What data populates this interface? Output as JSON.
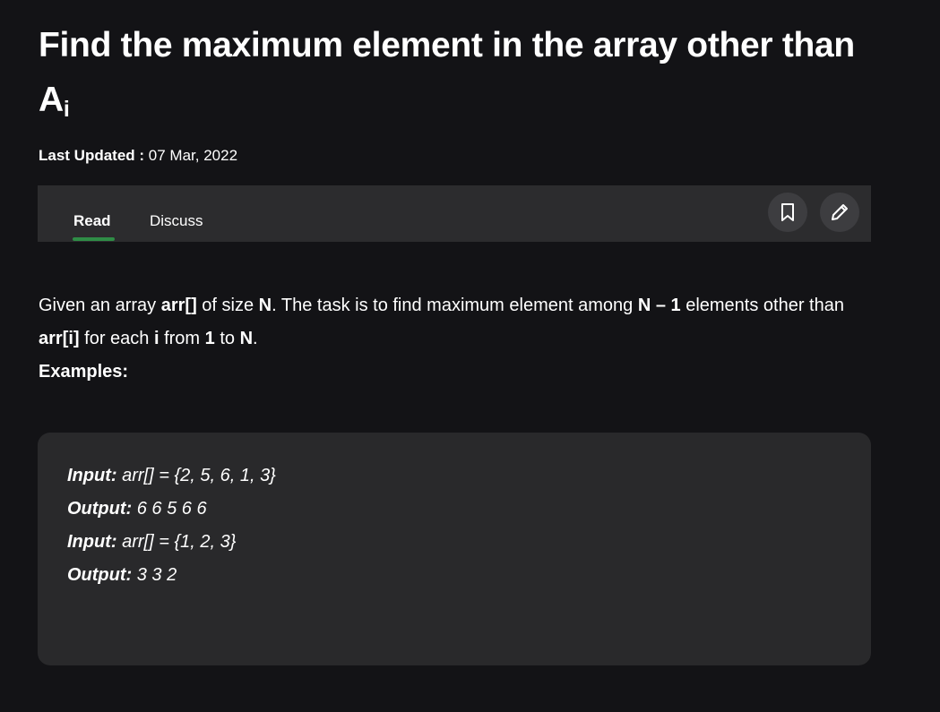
{
  "article": {
    "title": "Find the maximum element in the array other than A",
    "title_subscript": "i",
    "last_updated_label": "Last Updated :",
    "last_updated_date": "07 Mar, 2022"
  },
  "tabs": {
    "read": "Read",
    "discuss": "Discuss",
    "active": "Read",
    "accent_color": "#2f8d46"
  },
  "actions": {
    "bookmark_icon": "bookmark-icon",
    "edit_icon": "pencil-icon"
  },
  "description": {
    "s1": "Given an array ",
    "b1": "arr[]",
    "s2": " of size ",
    "b2": "N",
    "s3": ". The task is to find maximum element among ",
    "b3": "N – 1",
    "s4": " elements other than ",
    "b4": "arr[i]",
    "s5": " for each ",
    "b5": "i",
    "s6": " from ",
    "b6": "1",
    "s7": " to ",
    "b7": "N",
    "s8": ".",
    "examples_heading": "Examples:"
  },
  "examples": [
    {
      "label": "Input:",
      "value": " arr[] = {2, 5, 6, 1, 3}"
    },
    {
      "label": "Output:",
      "value": " 6 6 5 6 6"
    },
    {
      "label": "Input:",
      "value": " arr[] = {1, 2, 3}"
    },
    {
      "label": "Output:",
      "value": " 3 3 2"
    }
  ]
}
